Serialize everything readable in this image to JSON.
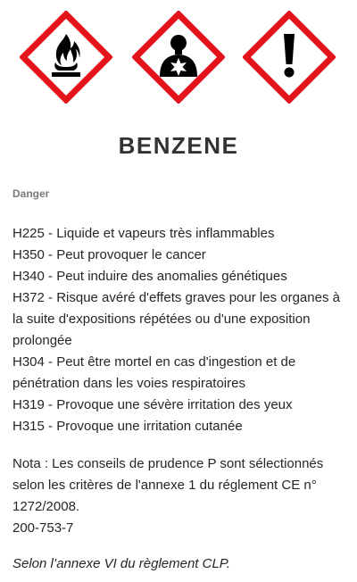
{
  "pictograms": [
    {
      "name": "flame-pictogram",
      "icon": "flame-icon"
    },
    {
      "name": "health-hazard-pictogram",
      "icon": "health-hazard-icon"
    },
    {
      "name": "exclamation-pictogram",
      "icon": "exclamation-icon"
    }
  ],
  "colors": {
    "diamond_border": "#e3141b",
    "symbol": "#000000",
    "title": "#333333",
    "signal": "#7a7a7a"
  },
  "title": "BENZENE",
  "signal_word": "Danger",
  "hazard_statements": [
    "H225 - Liquide et vapeurs très inflammables",
    "H350 - Peut provoquer le cancer",
    "H340 - Peut induire des anomalies génétiques",
    "H372 - Risque avéré d'effets graves pour les organes à la suite d'expositions répétées ou d'une exposition prolongée",
    "H304 - Peut être mortel en cas d'ingestion et de pénétration dans les voies respiratoires",
    "H319 - Provoque une sévère irritation des yeux",
    "H315 - Provoque une irritation cutanée"
  ],
  "note": "Nota : Les conseils de prudence P sont sélectionnés selon les critères de l'annexe 1 du réglement CE n° 1272/2008.",
  "cas_number": "200-753-7",
  "source": "Selon l’annexe VI du règlement CLP."
}
